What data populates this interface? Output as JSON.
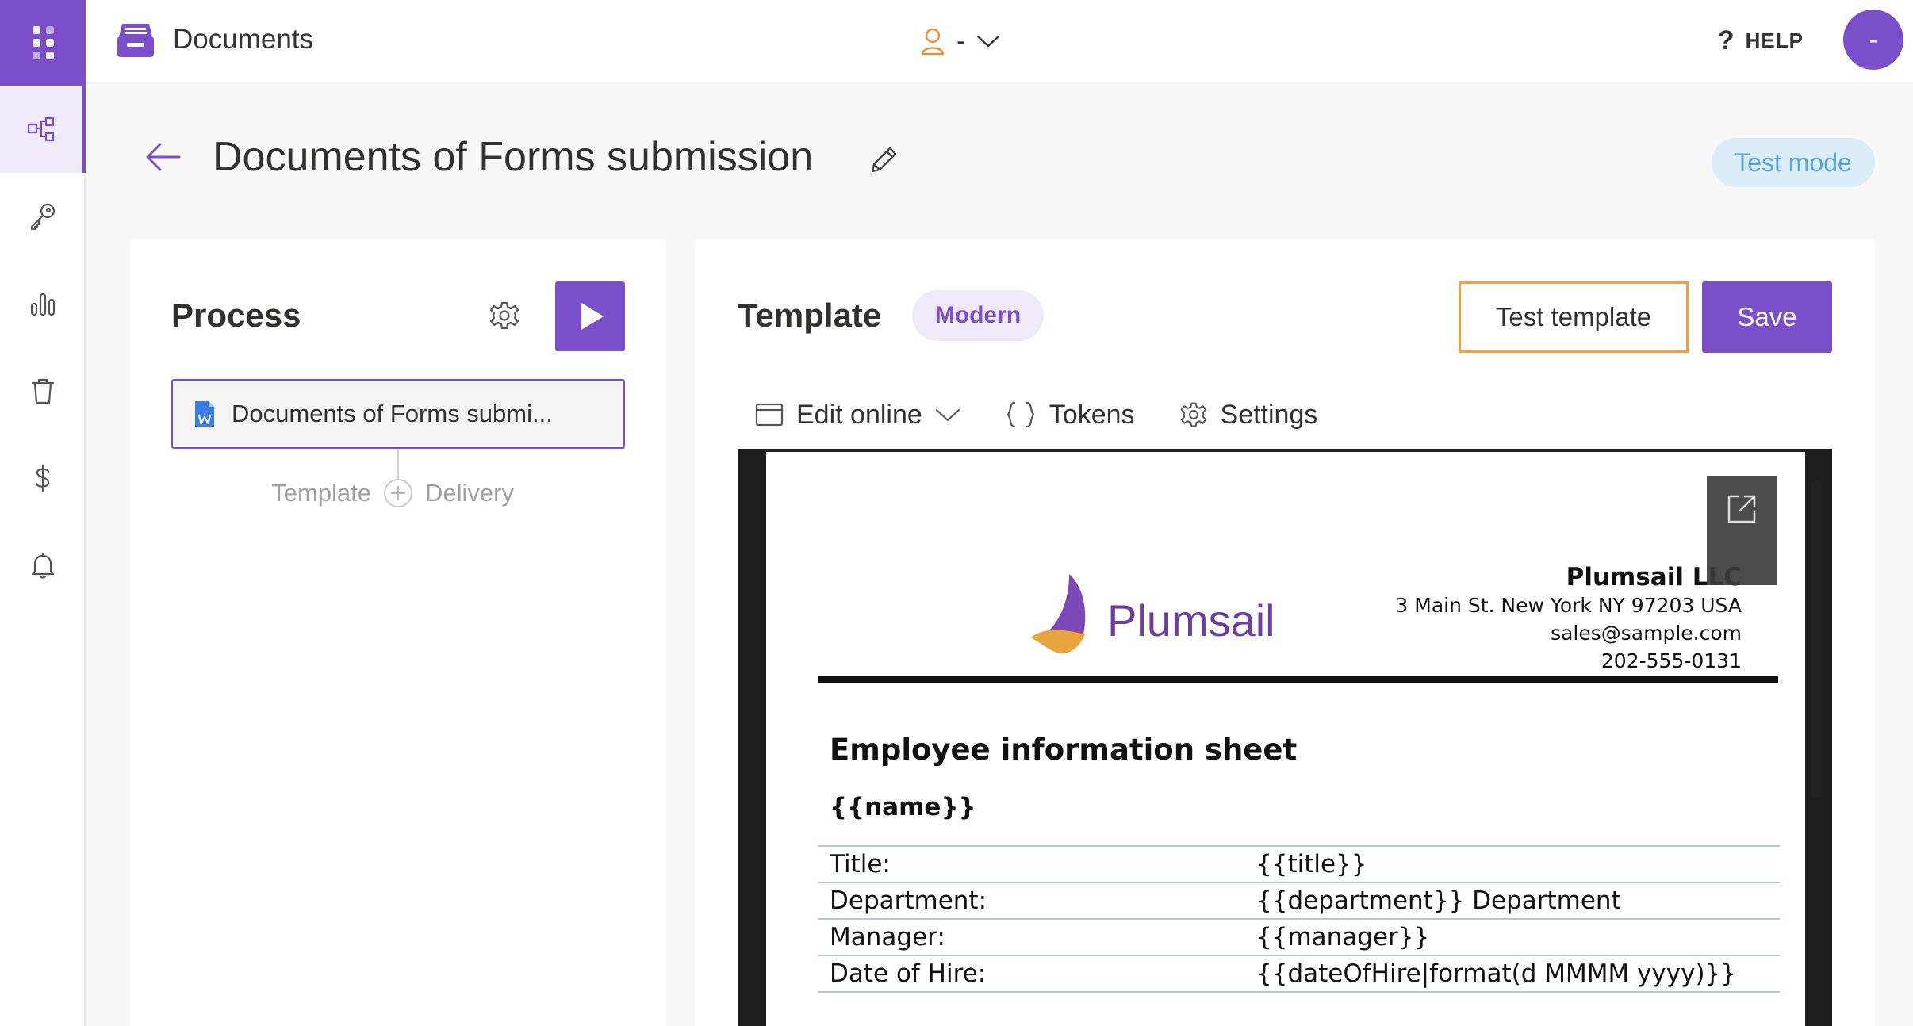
{
  "topbar": {
    "app_title": "Documents",
    "user_label": "-",
    "help_label": "HELP",
    "help_glyph": "?",
    "avatar_initial": "-"
  },
  "sidebar": {
    "items": [
      {
        "icon": "flow-icon",
        "active": true
      },
      {
        "icon": "key-icon",
        "active": false
      },
      {
        "icon": "bar-chart-icon",
        "active": false
      },
      {
        "icon": "trash-icon",
        "active": false
      },
      {
        "icon": "dollar-icon",
        "active": false
      },
      {
        "icon": "bell-icon",
        "active": false
      }
    ]
  },
  "page": {
    "title": "Documents of Forms submission",
    "test_mode_label": "Test mode"
  },
  "process": {
    "title": "Process",
    "doc_item_label": "Documents of Forms submi...",
    "flow_template_label": "Template",
    "flow_delivery_label": "Delivery"
  },
  "template": {
    "title": "Template",
    "badge": "Modern",
    "test_button": "Test template",
    "save_button": "Save",
    "toolbar": {
      "edit_online": "Edit online",
      "tokens": "Tokens",
      "settings": "Settings"
    }
  },
  "document": {
    "brand": "Plumsail",
    "company_name": "Plumsail LLC",
    "address": "3 Main St. New York NY 97203 USA",
    "email": "sales@sample.com",
    "phone": "202-555-0131",
    "sheet_title": "Employee information sheet",
    "name_token": "{{name}}",
    "rows": [
      {
        "key": "Title:",
        "value": "{{title}}"
      },
      {
        "key": "Department:",
        "value": "{{department}} Department"
      },
      {
        "key": "Manager:",
        "value": "{{manager}}"
      },
      {
        "key": "Date of Hire:",
        "value": "{{dateOfHire|format(d MMMM yyyy)}}"
      }
    ]
  },
  "colors": {
    "accent": "#7b4fc9",
    "test_outline": "#f0a040",
    "test_mode_bg": "#dcedfa",
    "test_mode_text": "#5aa3d9"
  }
}
